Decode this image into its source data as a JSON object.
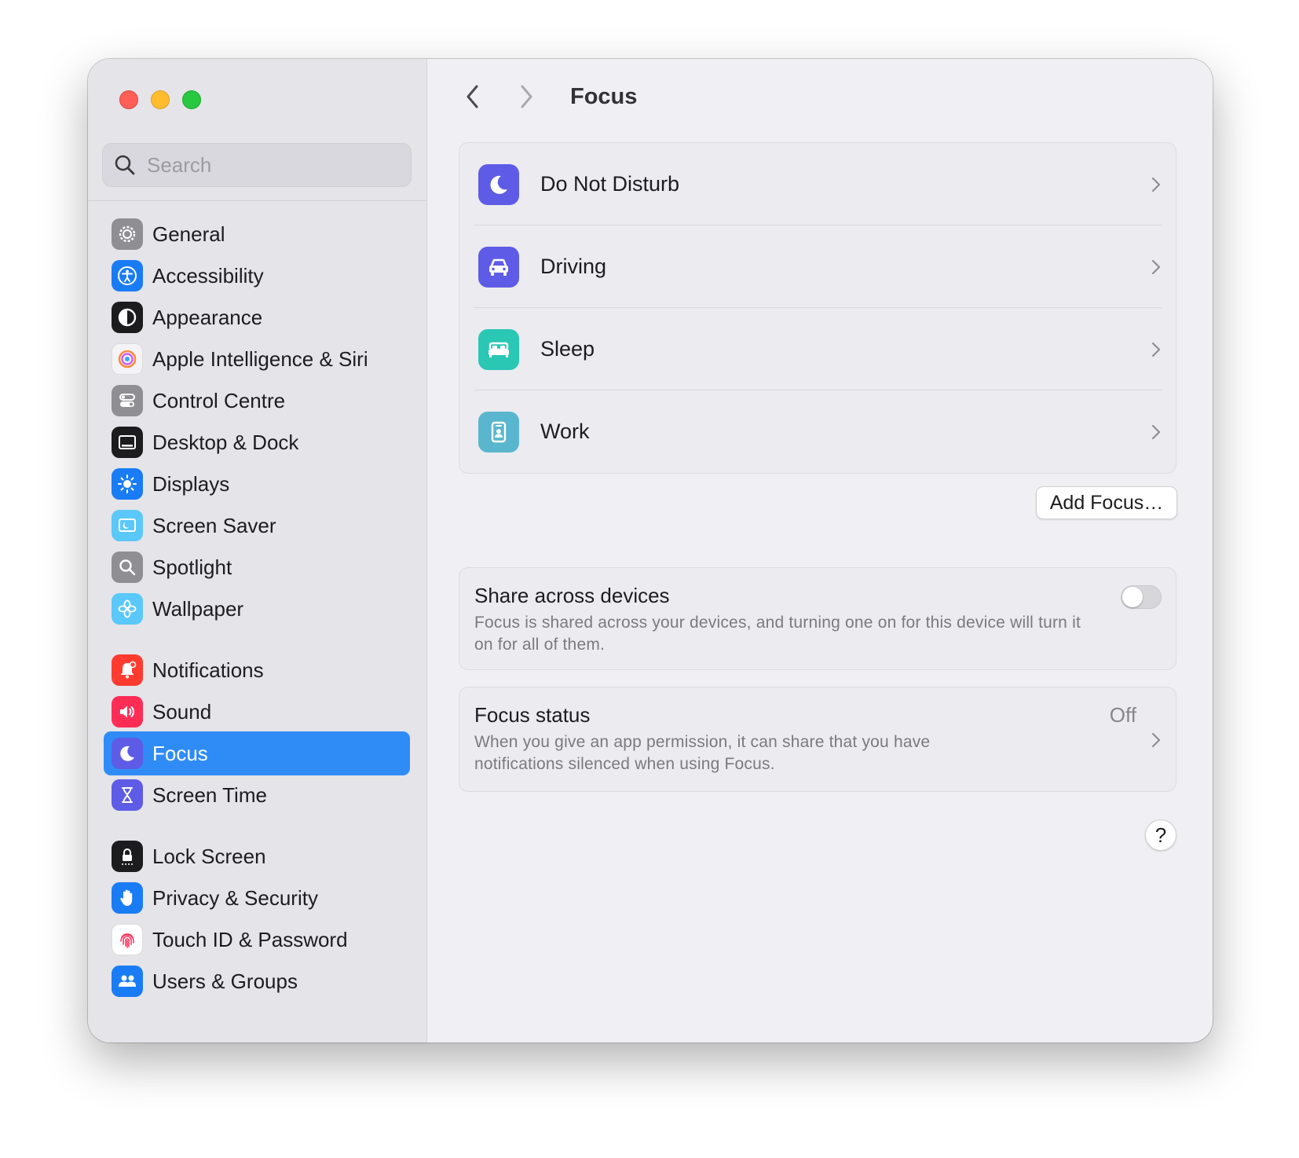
{
  "window": {
    "traffic_lights": [
      "close",
      "minimize",
      "zoom"
    ]
  },
  "sidebar": {
    "search": {
      "placeholder": "Search",
      "value": ""
    },
    "items": [
      {
        "label": "General",
        "icon": "gear-icon",
        "color": "#8e8e93"
      },
      {
        "label": "Accessibility",
        "icon": "accessibility-icon",
        "color": "#1a7cf5"
      },
      {
        "label": "Appearance",
        "icon": "appearance-icon",
        "color": "#1c1c1e"
      },
      {
        "label": "Apple Intelligence & Siri",
        "icon": "siri-icon",
        "color": "#f0f0f4"
      },
      {
        "label": "Control Centre",
        "icon": "control-centre-icon",
        "color": "#8e8e93"
      },
      {
        "label": "Desktop & Dock",
        "icon": "desktop-dock-icon",
        "color": "#1c1c1e"
      },
      {
        "label": "Displays",
        "icon": "displays-icon",
        "color": "#1a7cf5"
      },
      {
        "label": "Screen Saver",
        "icon": "screen-saver-icon",
        "color": "#5ac8fa"
      },
      {
        "label": "Spotlight",
        "icon": "spotlight-icon",
        "color": "#8e8e93"
      },
      {
        "label": "Wallpaper",
        "icon": "wallpaper-icon",
        "color": "#5ac8fa"
      },
      {
        "label": "Notifications",
        "icon": "notifications-icon",
        "color": "#ff3b30"
      },
      {
        "label": "Sound",
        "icon": "sound-icon",
        "color": "#ff2d55"
      },
      {
        "label": "Focus",
        "icon": "moon-icon",
        "color": "#5e5ce6",
        "selected": true
      },
      {
        "label": "Screen Time",
        "icon": "hourglass-icon",
        "color": "#5e5ce6"
      },
      {
        "label": "Lock Screen",
        "icon": "lock-icon",
        "color": "#1c1c1e"
      },
      {
        "label": "Privacy & Security",
        "icon": "hand-icon",
        "color": "#1a7cf5"
      },
      {
        "label": "Touch ID & Password",
        "icon": "fingerprint-icon",
        "color": "#ffffff"
      },
      {
        "label": "Users & Groups",
        "icon": "users-icon",
        "color": "#1a7cf5"
      }
    ]
  },
  "main": {
    "title": "Focus",
    "focus_modes": [
      {
        "label": "Do Not Disturb",
        "icon": "moon-icon",
        "color": "#5e5ce6"
      },
      {
        "label": "Driving",
        "icon": "car-icon",
        "color": "#5e5ce6"
      },
      {
        "label": "Sleep",
        "icon": "bed-icon",
        "color": "#2ac7b5"
      },
      {
        "label": "Work",
        "icon": "id-badge-icon",
        "color": "#5ab6cf"
      }
    ],
    "add_focus_label": "Add Focus…",
    "share": {
      "title": "Share across devices",
      "description": "Focus is shared across your devices, and turning one on for this device will turn it on for all of them.",
      "enabled": false
    },
    "focus_status": {
      "title": "Focus status",
      "value": "Off",
      "description": "When you give an app permission, it can share that you have notifications silenced when using Focus."
    },
    "help_label": "?"
  }
}
